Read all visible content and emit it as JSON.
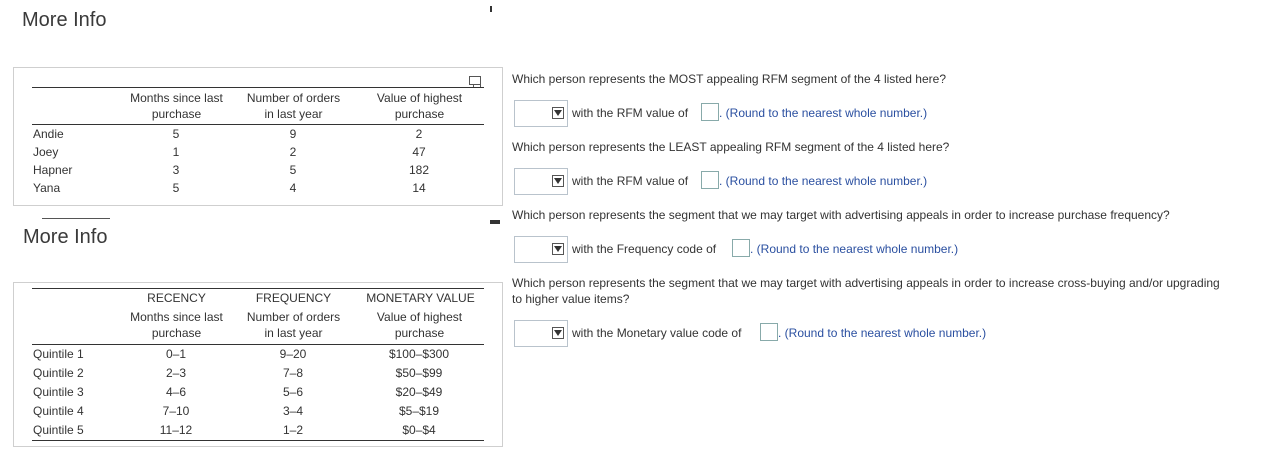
{
  "headings": {
    "top": "More Info",
    "middle": "More Info"
  },
  "table1": {
    "col_headers": [
      {
        "line1": "Months since last",
        "line2": "purchase"
      },
      {
        "line1": "Number of orders",
        "line2": "in last year"
      },
      {
        "line1": "Value of highest",
        "line2": "purchase"
      }
    ],
    "rows": [
      {
        "name": "Andie",
        "recency": "5",
        "frequency": "9",
        "value": "2"
      },
      {
        "name": "Joey",
        "recency": "1",
        "frequency": "2",
        "value": "47"
      },
      {
        "name": "Hapner",
        "recency": "3",
        "frequency": "5",
        "value": "182"
      },
      {
        "name": "Yana",
        "recency": "5",
        "frequency": "4",
        "value": "14"
      }
    ]
  },
  "table2": {
    "group_headers": [
      "RECENCY",
      "FREQUENCY",
      "MONETARY VALUE"
    ],
    "col_headers": [
      {
        "line1": "Months since last",
        "line2": "purchase"
      },
      {
        "line1": "Number of orders",
        "line2": "in last year"
      },
      {
        "line1": "Value of highest",
        "line2": "purchase"
      }
    ],
    "rows": [
      {
        "name": "Quintile 1",
        "recency": "0–1",
        "frequency": "9–20",
        "value": "$100–$300"
      },
      {
        "name": "Quintile 2",
        "recency": "2–3",
        "frequency": "7–8",
        "value": "$50–$99"
      },
      {
        "name": "Quintile 3",
        "recency": "4–6",
        "frequency": "5–6",
        "value": "$20–$49"
      },
      {
        "name": "Quintile 4",
        "recency": "7–10",
        "frequency": "3–4",
        "value": "$5–$19"
      },
      {
        "name": "Quintile 5",
        "recency": "11–12",
        "frequency": "1–2",
        "value": "$0–$4"
      }
    ]
  },
  "questions": [
    {
      "text": "Which person represents the MOST appealing RFM segment of the 4 listed here?",
      "text2": "",
      "label": "with the RFM value of",
      "hint": ". (Round to the nearest whole number.)"
    },
    {
      "text": "Which person represents the LEAST appealing RFM segment of the 4 listed here?",
      "text2": "",
      "label": "with the RFM value of",
      "hint": ". (Round to the nearest whole number.)"
    },
    {
      "text": "Which person represents the segment that we may target with advertising appeals in order to increase purchase frequency?",
      "text2": "",
      "label": "with the Frequency code of",
      "hint": ". (Round to the nearest whole number.)"
    },
    {
      "text": "Which person represents the segment that we may target with advertising appeals in order to increase cross-buying and/or upgrading",
      "text2": "to higher value items?",
      "label": "with the Monetary value code of",
      "hint": ". (Round to the nearest whole number.)"
    }
  ]
}
